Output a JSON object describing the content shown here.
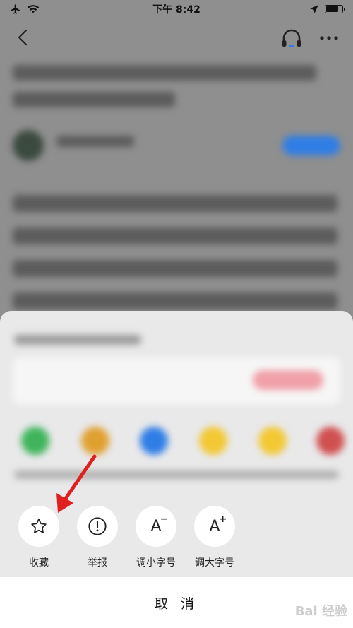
{
  "status_bar": {
    "time": "下午 8:42",
    "airplane_icon": "airplane-icon",
    "wifi_icon": "wifi-icon",
    "location_icon": "location-arrow-icon",
    "battery_level": 0.8
  },
  "nav": {
    "back_icon": "chevron-left-icon",
    "listen_icon": "headphone-icon",
    "more_icon": "more-dots-icon"
  },
  "actions": [
    {
      "label": "收藏",
      "icon": "star-icon"
    },
    {
      "label": "举报",
      "icon": "report-icon"
    },
    {
      "label": "调小字号",
      "icon": "font-decrease-icon",
      "glyph": "A",
      "mod": "−"
    },
    {
      "label": "调大字号",
      "icon": "font-increase-icon",
      "glyph": "A",
      "mod": "+"
    }
  ],
  "cancel_label": "取 消",
  "watermark": "Bai 经验",
  "colors": {
    "accent_blue": "#2f7ee6",
    "annotation_red": "#e02020",
    "panel_bg": "#e9e9ea"
  }
}
